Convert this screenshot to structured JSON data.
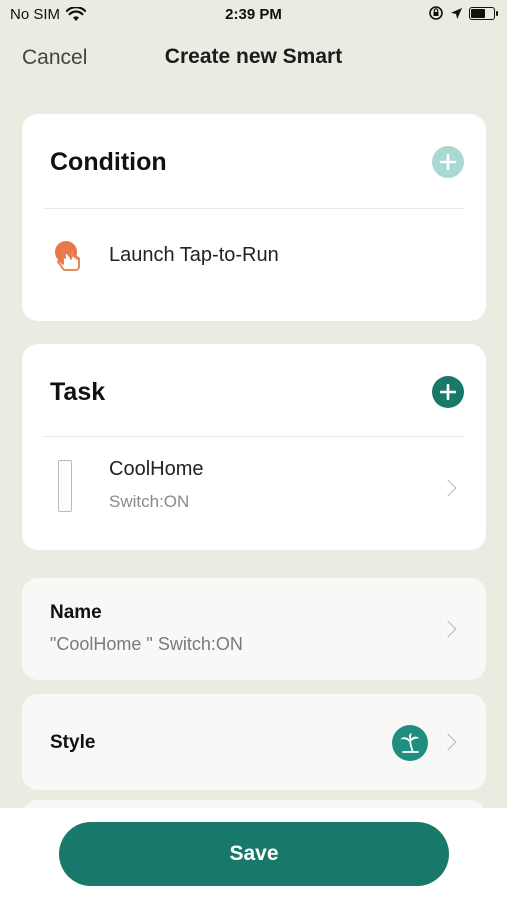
{
  "status_bar": {
    "carrier": "No SIM",
    "time": "2:39 PM"
  },
  "nav": {
    "cancel_label": "Cancel",
    "title": "Create new Smart"
  },
  "condition": {
    "heading": "Condition",
    "item_label": "Launch Tap-to-Run"
  },
  "task": {
    "heading": "Task",
    "device_name": "CoolHome",
    "device_action": "Switch:ON"
  },
  "name": {
    "label": "Name",
    "value": "\"CoolHome \" Switch:ON"
  },
  "style": {
    "label": "Style"
  },
  "save_label": "Save",
  "colors": {
    "accent": "#187869",
    "accent_light": "#a9d9d2",
    "background": "#e9ece1",
    "tap_icon": "#e8774a"
  }
}
